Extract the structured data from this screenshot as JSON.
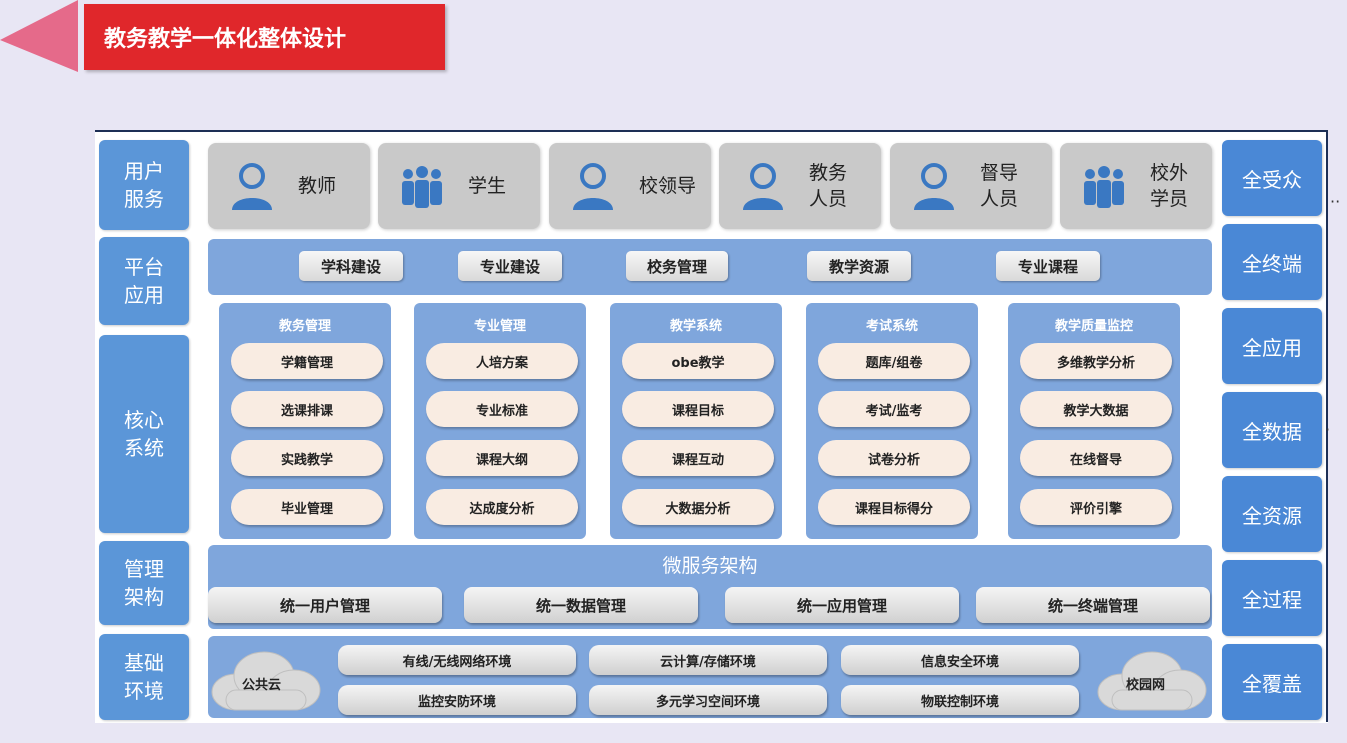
{
  "title": "教务教学一体化整体设计",
  "left_labels": [
    "用户\n服务",
    "平台\n应用",
    "核心\n系统",
    "管理\n架构",
    "基础\n环境"
  ],
  "right_labels": [
    "全受众",
    "全终端",
    "全应用",
    "全数据",
    "全资源",
    "全过程",
    "全覆盖"
  ],
  "users": [
    {
      "label": "教师",
      "icon": "person-icon"
    },
    {
      "label": "学生",
      "icon": "group-icon"
    },
    {
      "label": "校领导",
      "icon": "person-icon"
    },
    {
      "label": "教务\n人员",
      "icon": "person-icon"
    },
    {
      "label": "督导\n人员",
      "icon": "person-icon"
    },
    {
      "label": "校外\n学员",
      "icon": "group-icon"
    }
  ],
  "platform_apps": [
    "学科建设",
    "专业建设",
    "校务管理",
    "教学资源",
    "专业课程"
  ],
  "core_systems": [
    {
      "title": "教务管理",
      "items": [
        "学籍管理",
        "选课排课",
        "实践教学",
        "毕业管理"
      ]
    },
    {
      "title": "专业管理",
      "items": [
        "人培方案",
        "专业标准",
        "课程大纲",
        "达成度分析"
      ]
    },
    {
      "title": "教学系统",
      "items": [
        "obe教学",
        "课程目标",
        "课程互动",
        "大数据分析"
      ]
    },
    {
      "title": "考试系统",
      "items": [
        "题库/组卷",
        "考试/监考",
        "试卷分析",
        "课程目标得分"
      ]
    },
    {
      "title": "教学质量监控",
      "items": [
        "多维教学分析",
        "教学大数据",
        "在线督导",
        "评价引擎"
      ]
    }
  ],
  "microservice": {
    "title": "微服务架构",
    "items": [
      "统一用户管理",
      "统一数据管理",
      "统一应用管理",
      "统一终端管理"
    ]
  },
  "infrastructure": {
    "clouds": [
      "公共云",
      "校园网"
    ],
    "items": [
      "有线/无线网络环境",
      "云计算/存储环境",
      "信息安全环境",
      "监控安防环境",
      "多元学习空间环境",
      "物联控制环境"
    ]
  },
  "colors": {
    "title_bg": "#e0272b",
    "panel_blue": "#7fa6dc",
    "side_blue": "#5b96d8",
    "pill_bg": "#f9ece2"
  }
}
